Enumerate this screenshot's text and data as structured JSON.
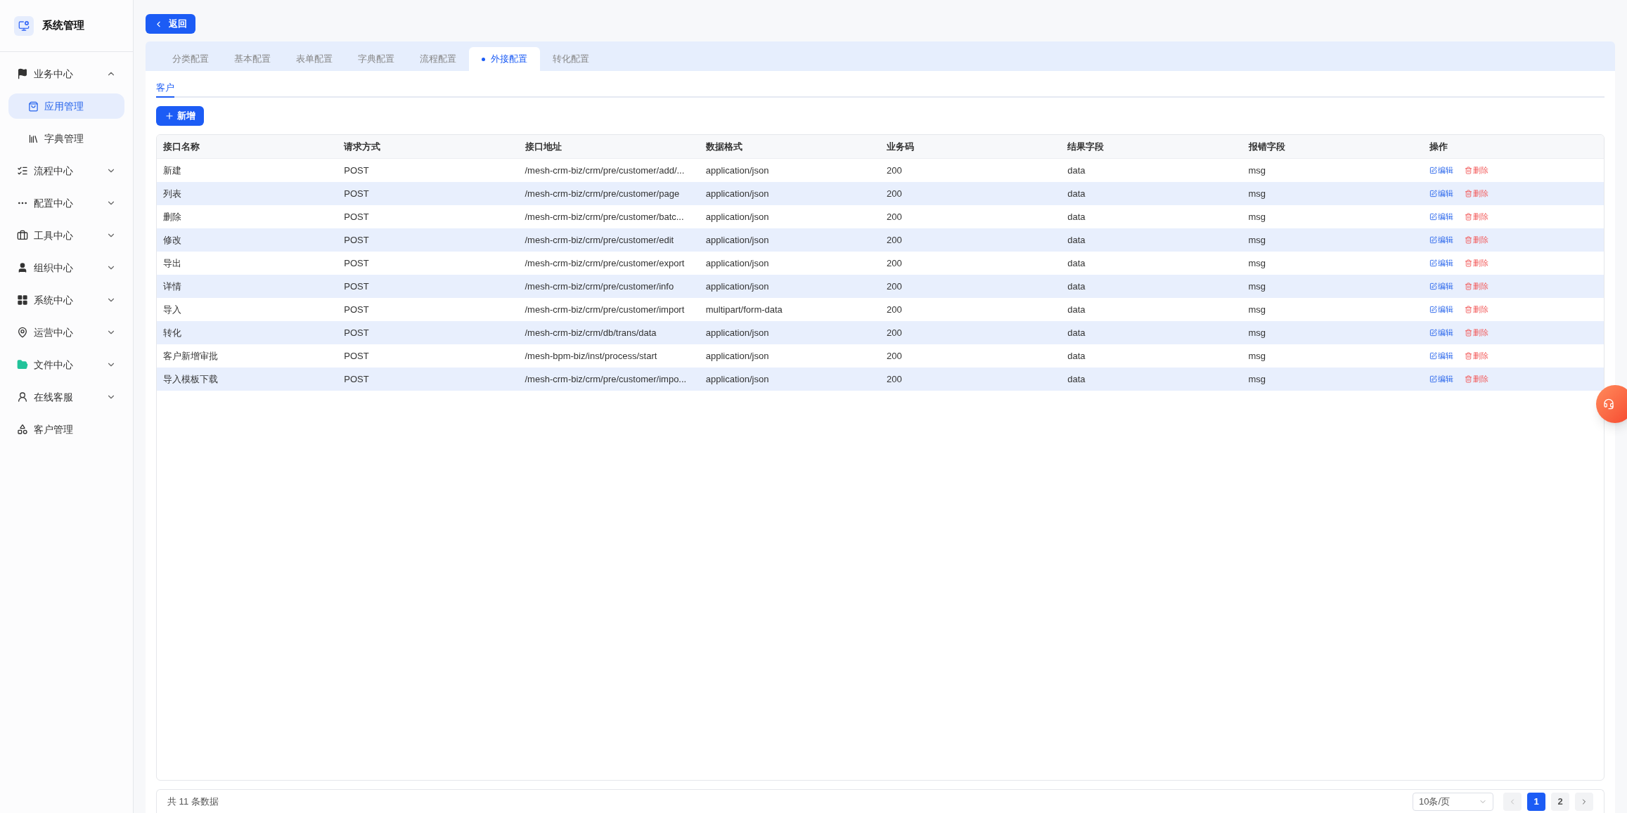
{
  "sidebar": {
    "title": "系统管理",
    "items": [
      {
        "kind": "group",
        "label": "业务中心",
        "expanded": true,
        "children": [
          {
            "label": "应用管理",
            "selected": true
          },
          {
            "label": "字典管理",
            "selected": false
          }
        ]
      },
      {
        "kind": "group",
        "label": "流程中心",
        "expanded": false
      },
      {
        "kind": "group",
        "label": "配置中心",
        "expanded": false
      },
      {
        "kind": "group",
        "label": "工具中心",
        "expanded": false
      },
      {
        "kind": "group",
        "label": "组织中心",
        "expanded": false
      },
      {
        "kind": "group",
        "label": "系统中心",
        "expanded": false
      },
      {
        "kind": "group",
        "label": "运营中心",
        "expanded": false
      },
      {
        "kind": "group",
        "label": "文件中心",
        "expanded": false
      },
      {
        "kind": "group",
        "label": "在线客服",
        "expanded": false
      },
      {
        "kind": "link",
        "label": "客户管理"
      }
    ]
  },
  "back_button": "返回",
  "tabs": [
    {
      "label": "分类配置",
      "selected": false
    },
    {
      "label": "基本配置",
      "selected": false
    },
    {
      "label": "表单配置",
      "selected": false
    },
    {
      "label": "字典配置",
      "selected": false
    },
    {
      "label": "流程配置",
      "selected": false
    },
    {
      "label": "外接配置",
      "selected": true
    },
    {
      "label": "转化配置",
      "selected": false
    }
  ],
  "sub_tabs": [
    {
      "label": "客户",
      "selected": true
    }
  ],
  "add_button": "新增",
  "table": {
    "columns": [
      "接口名称",
      "请求方式",
      "接口地址",
      "数据格式",
      "业务码",
      "结果字段",
      "报错字段",
      "操作"
    ],
    "rows": [
      {
        "cells": [
          "新建",
          "POST",
          "/mesh-crm-biz/crm/pre/customer/add/...",
          "application/json",
          "200",
          "data",
          "msg"
        ],
        "actions": [
          "编辑",
          "删除"
        ]
      },
      {
        "cells": [
          "列表",
          "POST",
          "/mesh-crm-biz/crm/pre/customer/page",
          "application/json",
          "200",
          "data",
          "msg"
        ],
        "actions": [
          "编辑",
          "删除"
        ]
      },
      {
        "cells": [
          "删除",
          "POST",
          "/mesh-crm-biz/crm/pre/customer/batc...",
          "application/json",
          "200",
          "data",
          "msg"
        ],
        "actions": [
          "编辑",
          "删除"
        ]
      },
      {
        "cells": [
          "修改",
          "POST",
          "/mesh-crm-biz/crm/pre/customer/edit",
          "application/json",
          "200",
          "data",
          "msg"
        ],
        "actions": [
          "编辑",
          "删除"
        ]
      },
      {
        "cells": [
          "导出",
          "POST",
          "/mesh-crm-biz/crm/pre/customer/export",
          "application/json",
          "200",
          "data",
          "msg"
        ],
        "actions": [
          "编辑",
          "删除"
        ]
      },
      {
        "cells": [
          "详情",
          "POST",
          "/mesh-crm-biz/crm/pre/customer/info",
          "application/json",
          "200",
          "data",
          "msg"
        ],
        "actions": [
          "编辑",
          "删除"
        ]
      },
      {
        "cells": [
          "导入",
          "POST",
          "/mesh-crm-biz/crm/pre/customer/import",
          "multipart/form-data",
          "200",
          "data",
          "msg"
        ],
        "actions": [
          "编辑",
          "删除"
        ]
      },
      {
        "cells": [
          "转化",
          "POST",
          "/mesh-crm-biz/crm/db/trans/data",
          "application/json",
          "200",
          "data",
          "msg"
        ],
        "actions": [
          "编辑",
          "删除"
        ]
      },
      {
        "cells": [
          "客户新增审批",
          "POST",
          "/mesh-bpm-biz/inst/process/start",
          "application/json",
          "200",
          "data",
          "msg"
        ],
        "actions": [
          "编辑",
          "删除"
        ]
      },
      {
        "cells": [
          "导入模板下载",
          "POST",
          "/mesh-crm-biz/crm/pre/customer/impo...",
          "application/json",
          "200",
          "data",
          "msg"
        ],
        "actions": [
          "编辑",
          "删除"
        ]
      }
    ]
  },
  "pagination": {
    "total": "共 11 条数据",
    "page_size": "10条/页",
    "pages": [
      {
        "label": "1",
        "selected": true
      },
      {
        "label": "2",
        "selected": false
      }
    ]
  }
}
